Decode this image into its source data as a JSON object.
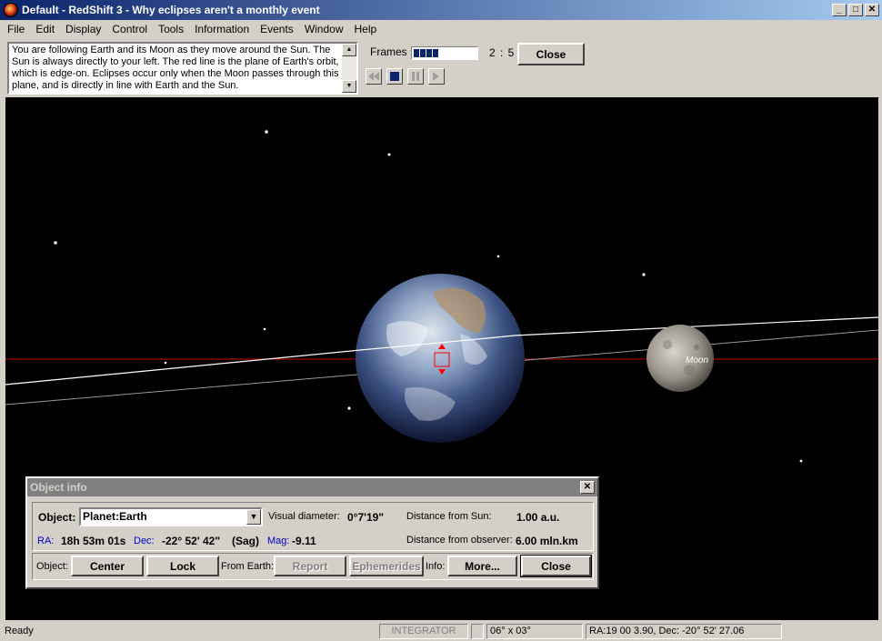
{
  "window": {
    "title": "Default - RedShift 3 -  Why eclipses aren't a monthly event",
    "minimize": "_",
    "maximize": "□",
    "close": "✕"
  },
  "menu": [
    "File",
    "Edit",
    "Display",
    "Control",
    "Tools",
    "Information",
    "Events",
    "Window",
    "Help"
  ],
  "control": {
    "description": "You are following Earth and its Moon as they move around the Sun. The Sun is always directly to your left. The red line is the plane of Earth's orbit, which is edge-on. Eclipses occur only when the Moon passes through this plane, and is directly in line with Earth and the Sun.",
    "frames_label": "Frames",
    "frame_progress": 0.4,
    "frame_count": "2 : 5",
    "close_label": "Close",
    "playback_icons": [
      "rewind-icon",
      "stop-icon",
      "pause-icon",
      "step-forward-icon"
    ]
  },
  "space": {
    "moon_label": "Moon"
  },
  "object_info": {
    "title": "Object info",
    "object_label": "Object:",
    "object_value": "Planet:Earth",
    "visual_diameter_label": "Visual diameter:",
    "visual_diameter_value": "0°7'19\"",
    "distance_sun_label": "Distance from Sun:",
    "distance_sun_value": "1.00 a.u.",
    "ra_label": "RA:",
    "ra_value": "18h 53m 01s",
    "dec_label": "Dec:",
    "dec_value": "-22° 52' 42\"",
    "constellation": "(Sag)",
    "mag_label": "Mag:",
    "mag_value": "-9.11",
    "distance_observer_label": "Distance from observer:",
    "distance_observer_value": "6.00 mln.km",
    "object_row_label": "Object:",
    "center_label": "Center",
    "lock_label": "Lock",
    "from_earth_label": "From Earth:",
    "report_label": "Report",
    "ephemerides_label": "Ephemerides",
    "info_label": "Info:",
    "more_label": "More...",
    "close_label": "Close"
  },
  "status": {
    "ready": "Ready",
    "integrator": "INTEGRATOR",
    "fov": "06° x 03°",
    "coords": "RA:19 00  3.90, Dec: -20° 52' 27.06"
  }
}
